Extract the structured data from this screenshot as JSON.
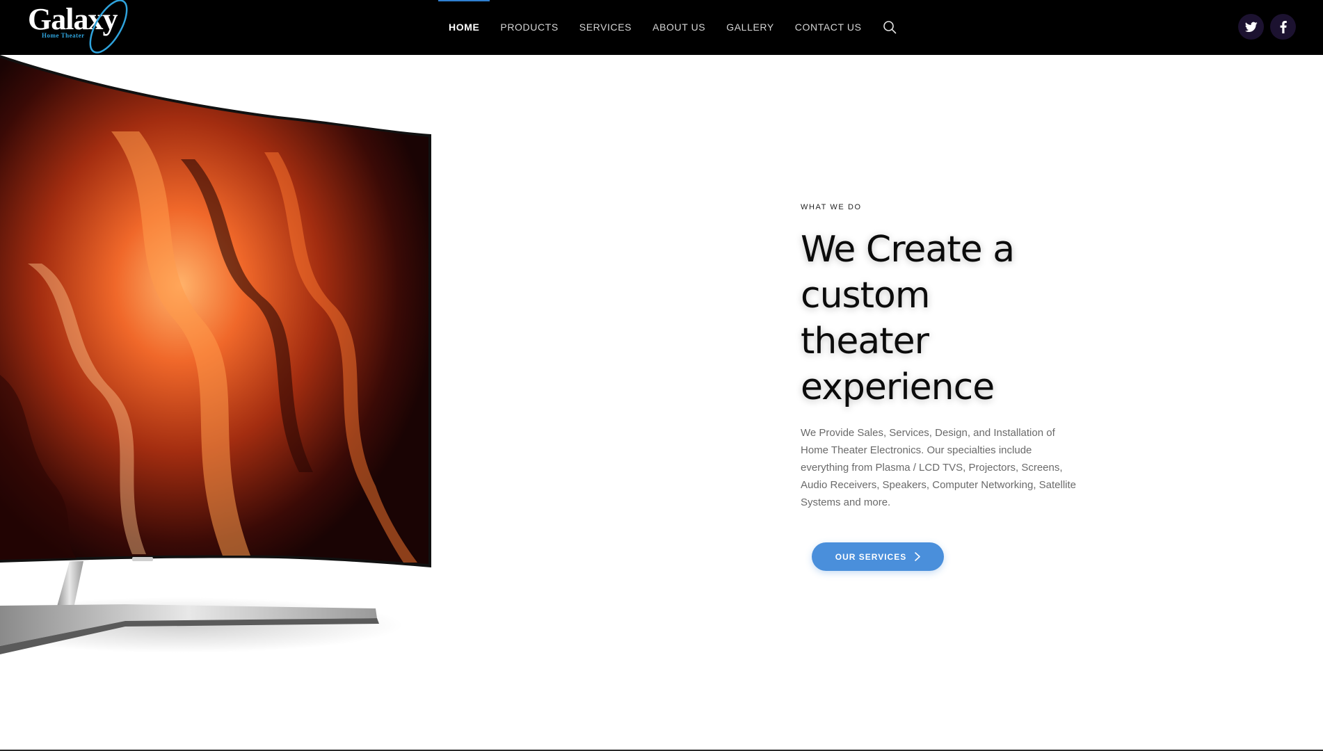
{
  "brand": {
    "logo_text": "Galaxy",
    "logo_subtitle": "Home Theater",
    "accent_color": "#2fa3dc"
  },
  "nav": {
    "items": [
      {
        "label": "HOME",
        "active": true
      },
      {
        "label": "PRODUCTS",
        "active": false
      },
      {
        "label": "SERVICES",
        "active": false
      },
      {
        "label": "ABOUT US",
        "active": false
      },
      {
        "label": "GALLERY",
        "active": false
      },
      {
        "label": "CONTACT US",
        "active": false
      }
    ],
    "search_icon": "search-icon",
    "active_indicator_color": "#2f7fd0"
  },
  "social": [
    {
      "icon": "twitter-icon"
    },
    {
      "icon": "facebook-icon"
    }
  ],
  "hero": {
    "eyebrow": "WHAT WE DO",
    "headline_lines": [
      "We Create a",
      "custom",
      "theater",
      "experience"
    ],
    "description": "We Provide Sales, Services, Design, and Installation of Home Theater Electronics. Our specialties include everything from Plasma / LCD TVS, Projectors, Screens, Audio Receivers, Speakers, Computer Networking, Satellite Systems and more.",
    "cta_label": "OUR SERVICES",
    "cta_color": "#4a8fdb"
  }
}
